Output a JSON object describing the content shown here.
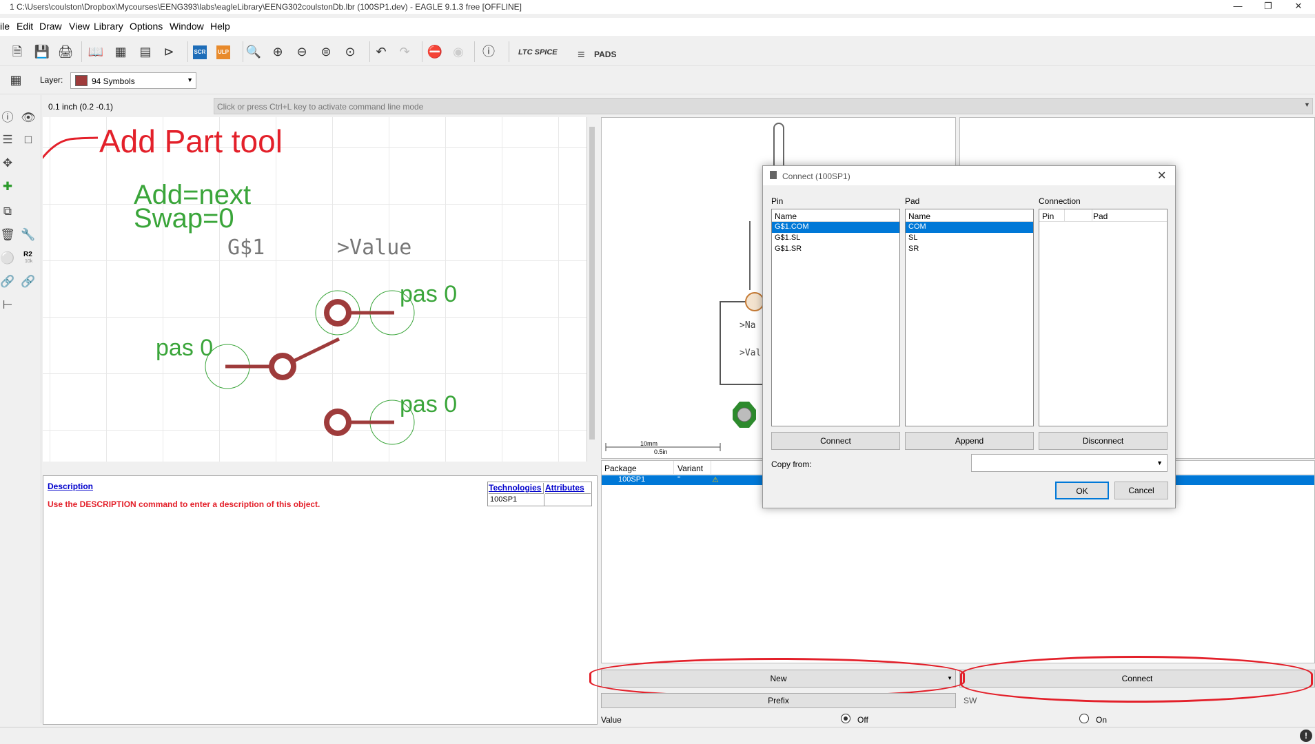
{
  "window": {
    "title": "1 C:\\Users\\coulston\\Dropbox\\Mycourses\\EENG393\\labs\\eagleLibrary\\EENG302coulstonDb.lbr (100SP1.dev) - EAGLE 9.1.3 free [OFFLINE]"
  },
  "menu": {
    "file": "ile",
    "edit": "Edit",
    "draw": "Draw",
    "view": "View",
    "library": "Library",
    "options": "Options",
    "window": "Window",
    "help": "Help"
  },
  "toolbar": {
    "scr": "SCR",
    "ulp": "ULP",
    "ltc": "LTC SPICE",
    "pads": "PADS"
  },
  "layer": {
    "label": "Layer:",
    "value": "94 Symbols"
  },
  "coords": "0.1 inch (0.2 -0.1)",
  "command": {
    "placeholder": "Click or press Ctrl+L key to activate command line mode"
  },
  "sidebar": {
    "r2": "R2",
    "r2sub": "10k"
  },
  "canvas": {
    "annotation": "Add Part tool",
    "add": "Add=next",
    "swap": "Swap=0",
    "gate": "G$1",
    "value": ">Value",
    "pin1": "pas 0",
    "pin2": "pas 0",
    "pin3": "pas 0"
  },
  "description": {
    "title": "Description",
    "text": "Use the DESCRIPTION command to enter a description of this object.",
    "technologies": "Technologies",
    "attributes": "Attributes",
    "tech_row": "100SP1"
  },
  "preview": {
    "name": ">Na",
    "value": ">Val",
    "scale_mm": "10mm",
    "scale_in": "0.5in"
  },
  "package_table": {
    "col_package": "Package",
    "col_variant": "Variant",
    "row_package": "100SP1",
    "row_variant": "''"
  },
  "bottom": {
    "new": "New",
    "connect": "Connect",
    "prefix": "Prefix",
    "sw": "SW",
    "value": "Value",
    "off": "Off",
    "on": "On"
  },
  "dialog": {
    "title": "Connect  (100SP1)",
    "pin_label": "Pin",
    "pad_label": "Pad",
    "connection_label": "Connection",
    "name_header": "Name",
    "pad_name_header": "Name",
    "conn_pin": "Pin",
    "conn_pad": "Pad",
    "pins": [
      "G$1.COM",
      "G$1.SL",
      "G$1.SR"
    ],
    "pads": [
      "COM",
      "SL",
      "SR"
    ],
    "connect_btn": "Connect",
    "append_btn": "Append",
    "disconnect_btn": "Disconnect",
    "copy_from": "Copy from:",
    "ok": "OK",
    "cancel": "Cancel"
  },
  "colors": {
    "annotation_red": "#e3202a",
    "canvas_green": "#3aa53a",
    "symbol_red": "#9e3b3b",
    "selection_blue": "#0078d7"
  }
}
